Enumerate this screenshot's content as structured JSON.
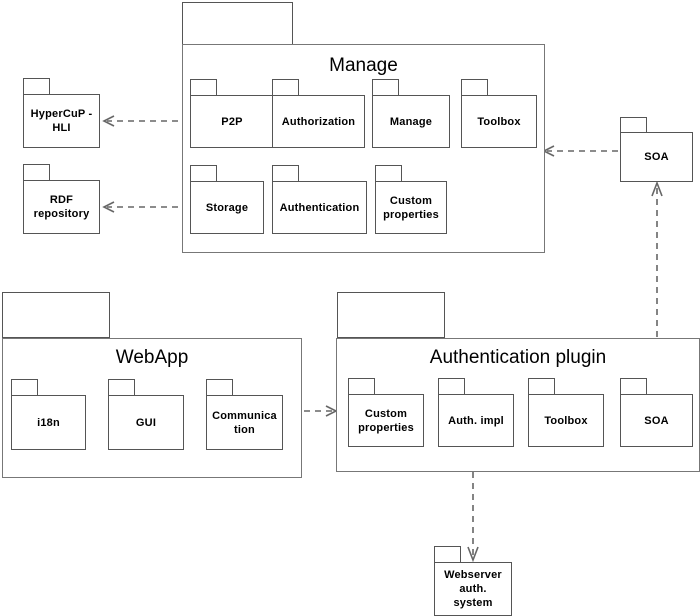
{
  "diagram": {
    "title": "Component / package architecture diagram",
    "stroke_color": "#555555",
    "container_stroke_color": "#777777",
    "arrow_color": "#666666",
    "background": "#ffffff"
  },
  "containers": [
    {
      "id": "manage",
      "title": "Manage",
      "packages": [
        {
          "id": "p2p",
          "label": "P2P"
        },
        {
          "id": "authorization",
          "label": "Authorization"
        },
        {
          "id": "manage-inner",
          "label": "Manage"
        },
        {
          "id": "toolbox-manage",
          "label": "Toolbox"
        },
        {
          "id": "storage",
          "label": "Storage"
        },
        {
          "id": "authentication",
          "label": "Authentication"
        },
        {
          "id": "custom-properties-manage",
          "label": "Custom\nproperties"
        }
      ]
    },
    {
      "id": "webapp",
      "title": "WebApp",
      "packages": [
        {
          "id": "i18n",
          "label": "i18n"
        },
        {
          "id": "gui",
          "label": "GUI"
        },
        {
          "id": "communication",
          "label": "Communica\ntion"
        }
      ]
    },
    {
      "id": "authentication-plugin",
      "title": "Authentication plugin",
      "packages": [
        {
          "id": "custom-properties-plugin",
          "label": "Custom\nproperties"
        },
        {
          "id": "auth-impl",
          "label": "Auth. impl"
        },
        {
          "id": "toolbox-plugin",
          "label": "Toolbox"
        },
        {
          "id": "soa-plugin",
          "label": "SOA"
        }
      ]
    }
  ],
  "standalone_packages": [
    {
      "id": "hypercup-hli",
      "label": "HyperCuP -\nHLI"
    },
    {
      "id": "rdf-repository",
      "label": "RDF\nrepository"
    },
    {
      "id": "soa-top",
      "label": "SOA"
    },
    {
      "id": "webserver-auth-system",
      "label": "Webserver\nauth.\nsystem"
    }
  ],
  "labels": {
    "manage_title": "Manage",
    "webapp_title": "WebApp",
    "auth_plugin_title": "Authentication plugin",
    "p2p": "P2P",
    "authorization": "Authorization",
    "manage_inner": "Manage",
    "toolbox_manage": "Toolbox",
    "storage": "Storage",
    "authentication": "Authentication",
    "custom_properties_manage_line1": "Custom",
    "custom_properties_manage_line2": "properties",
    "hypercup_line1": "HyperCuP -",
    "hypercup_line2": "HLI",
    "rdf_line1": "RDF",
    "rdf_line2": "repository",
    "soa_top": "SOA",
    "i18n": "i18n",
    "gui": "GUI",
    "communication_line1": "Communica",
    "communication_line2": "tion",
    "custom_properties_plugin_line1": "Custom",
    "custom_properties_plugin_line2": "properties",
    "auth_impl": "Auth. impl",
    "toolbox_plugin": "Toolbox",
    "soa_plugin": "SOA",
    "webserver_line1": "Webserver",
    "webserver_line2": "auth.",
    "webserver_line3": "system"
  },
  "dependencies": [
    {
      "id": "p2p-to-hypercup",
      "from": "p2p",
      "to": "hypercup-hli",
      "style": "dashed"
    },
    {
      "id": "storage-to-rdf",
      "from": "storage",
      "to": "rdf-repository",
      "style": "dashed"
    },
    {
      "id": "soa-top-to-manage",
      "from": "soa-top",
      "to": "manage",
      "style": "dashed"
    },
    {
      "id": "soa-plugin-to-soa-top",
      "from": "soa-plugin",
      "to": "soa-top",
      "style": "dashed"
    },
    {
      "id": "communication-to-custom-properties",
      "from": "communication",
      "to": "custom-properties-plugin",
      "style": "dashed"
    },
    {
      "id": "auth-impl-to-webserver",
      "from": "auth-impl",
      "to": "webserver-auth-system",
      "style": "dashed"
    }
  ]
}
